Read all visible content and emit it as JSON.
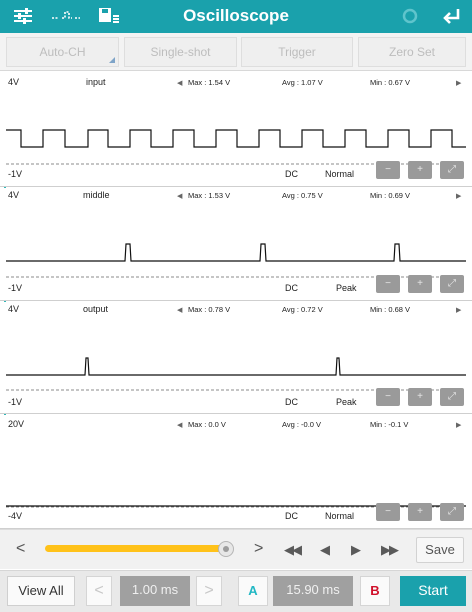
{
  "header": {
    "title": "Oscilloscope",
    "icons": [
      "sliders-icon",
      "waveform-dots-icon",
      "save-list-icon",
      "refresh-icon",
      "back-icon"
    ]
  },
  "toolbar": {
    "auto_ch": "Auto-CH",
    "single_shot": "Single-shot",
    "trigger": "Trigger",
    "zero_set": "Zero Set"
  },
  "channels": [
    {
      "scale_top": "4V",
      "name": "input",
      "max": "Max : 1.54 V",
      "avg": "Avg : 1.07 V",
      "min": "Min : 0.67 V",
      "scale_bottom": "-1V",
      "coupling": "DC",
      "mode": "Normal"
    },
    {
      "scale_top": "4V",
      "name": "middle",
      "max": "Max : 1.53 V",
      "avg": "Avg : 0.75 V",
      "min": "Min : 0.69 V",
      "scale_bottom": "-1V",
      "coupling": "DC",
      "mode": "Peak"
    },
    {
      "scale_top": "4V",
      "name": "output",
      "max": "Max : 0.78 V",
      "avg": "Avg : 0.72 V",
      "min": "Min : 0.68 V",
      "scale_bottom": "-1V",
      "coupling": "DC",
      "mode": "Peak"
    },
    {
      "scale_top": "20V",
      "name": "",
      "max": "Max : 0.0 V",
      "avg": "Avg : -0.0 V",
      "min": "Min : -0.1 V",
      "scale_bottom": "-4V",
      "coupling": "DC",
      "mode": "Normal"
    }
  ],
  "playback": {
    "save_label": "Save"
  },
  "bottom": {
    "view_all": "View All",
    "time_div": "1.00 ms",
    "cursor_a": "A",
    "cursor_delta": "15.90 ms",
    "cursor_b": "B",
    "start": "Start"
  },
  "colors": {
    "header": "#1aa1ac",
    "slider": "#ffc21a",
    "cursor_a": "#22b8c4",
    "cursor_b": "#d0102a",
    "start": "#1aa1ac"
  }
}
